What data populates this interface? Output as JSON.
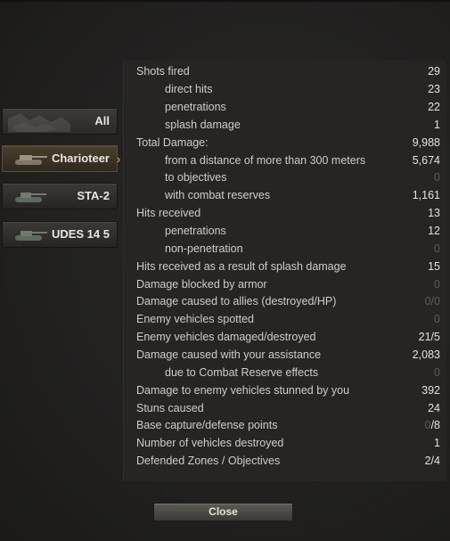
{
  "tabs": [
    {
      "label": "All",
      "icon": "camo-pattern-icon"
    },
    {
      "label": "Charioteer",
      "icon": "tank-icon",
      "selected": true
    },
    {
      "label": "STA-2",
      "icon": "tank-icon"
    },
    {
      "label": "UDES 14 5",
      "icon": "tank-icon"
    }
  ],
  "stats": [
    {
      "label": "Shots fired",
      "value": "29"
    },
    {
      "label": "direct hits",
      "value": "23"
    },
    {
      "label": "penetrations",
      "value": "22"
    },
    {
      "label": "splash damage",
      "value": "1"
    },
    {
      "label": "Total Damage:",
      "value": "9,988"
    },
    {
      "label": "from a distance of more than 300 meters",
      "value": "5,674"
    },
    {
      "label": "to objectives",
      "value": "0"
    },
    {
      "label": "with combat reserves",
      "value": "1,161"
    },
    {
      "label": "Hits received",
      "value": "13"
    },
    {
      "label": "penetrations",
      "value": "12"
    },
    {
      "label": "non-penetration",
      "value": "0"
    },
    {
      "label": "Hits received as a result of splash damage",
      "value": "15"
    },
    {
      "label": "Damage blocked by armor",
      "value": "0"
    },
    {
      "label": "Damage caused to allies (destroyed/HP)",
      "value": "0/0"
    },
    {
      "label": "Enemy vehicles spotted",
      "value": "0"
    },
    {
      "label": "Enemy vehicles damaged/destroyed",
      "value": "21/5"
    },
    {
      "label": "Damage caused with your assistance",
      "value": "2,083"
    },
    {
      "label": "due to Combat Reserve effects",
      "value": "0"
    },
    {
      "label": "Damage to enemy vehicles stunned by you",
      "value": "392"
    },
    {
      "label": "Stuns caused",
      "value": "24"
    },
    {
      "label": "Base capture/defense points",
      "value": "0/8"
    },
    {
      "label": "Number of vehicles destroyed",
      "value": "1"
    },
    {
      "label": "Defended Zones / Objectives",
      "value": "2/4"
    }
  ],
  "close_label": "Close",
  "colors": {
    "value_dim": "#5d5b56",
    "tab_active": "#4b3f2c",
    "accent": "#d8b46c"
  }
}
